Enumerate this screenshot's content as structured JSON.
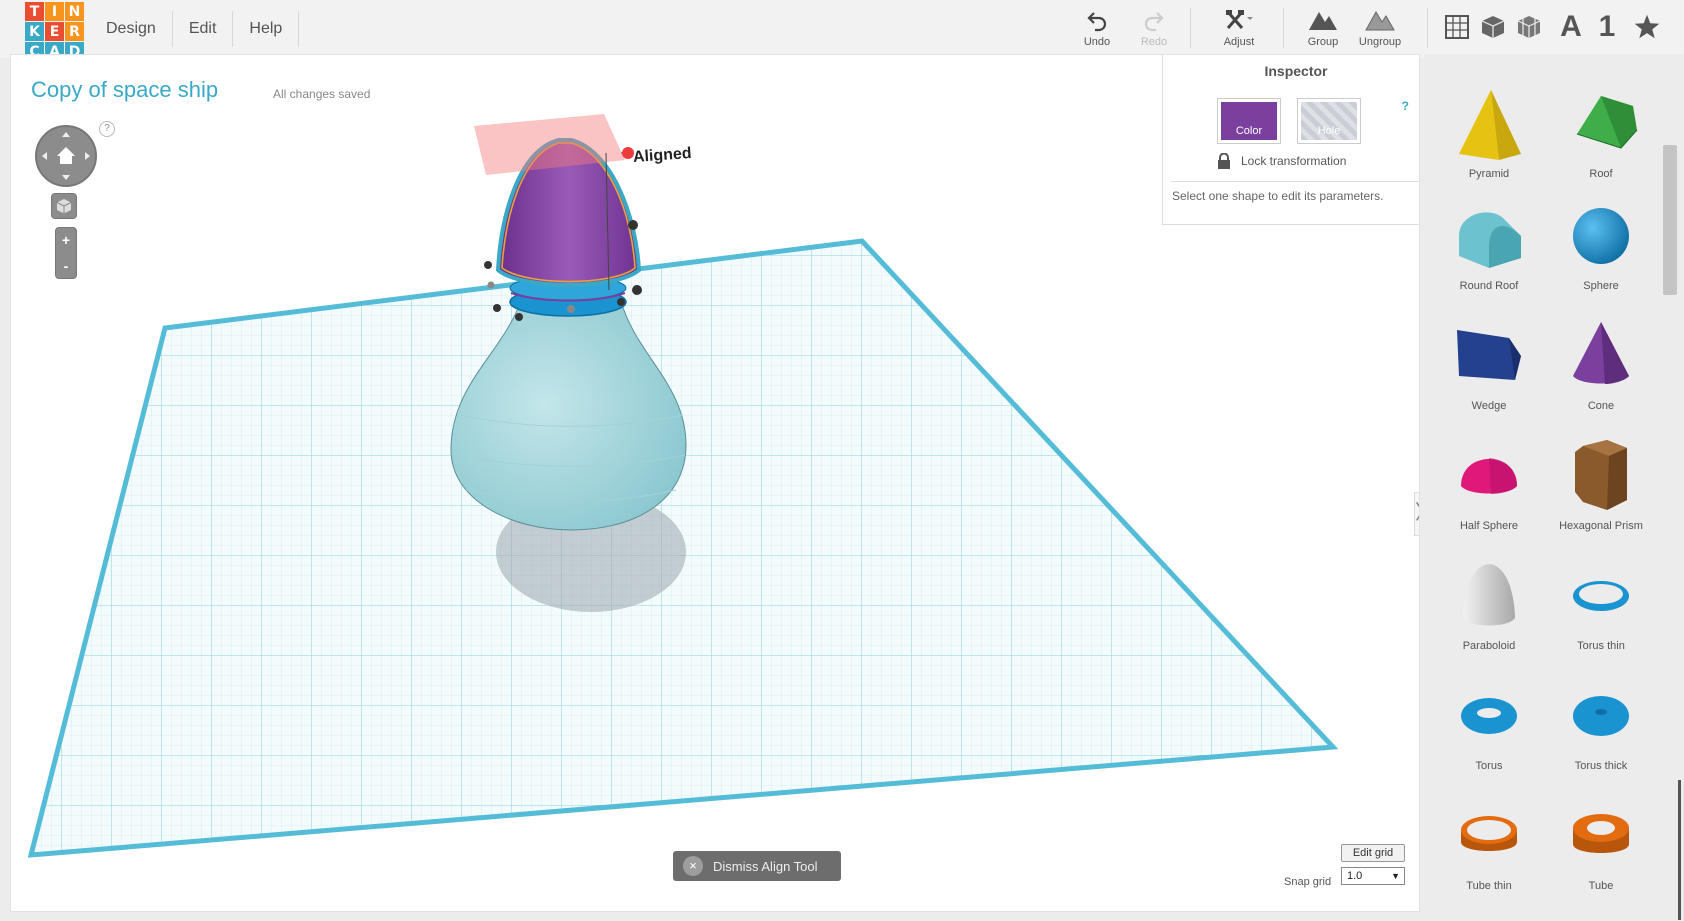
{
  "app": {
    "logo_letters": [
      "T",
      "I",
      "N",
      "K",
      "E",
      "R",
      "C",
      "A",
      "D"
    ],
    "logo_colors": [
      "#e94e33",
      "#f7941e",
      "#f7941e",
      "#3aa9c6",
      "#e94e33",
      "#f7941e",
      "#3aa9c6",
      "#3aa9c6",
      "#3aa9c6"
    ],
    "accent_color": "#3aa9c6"
  },
  "menu": [
    "Design",
    "Edit",
    "Help"
  ],
  "toolbar": {
    "undo": "Undo",
    "redo": "Redo",
    "adjust": "Adjust",
    "group": "Group",
    "ungroup": "Ungroup",
    "view_icons": [
      "grid-view-icon",
      "box-icon",
      "wireframe-box-icon",
      "text-shape-icon",
      "number-shape-icon",
      "star-shape-icon"
    ],
    "text_letter": "A",
    "number_digit": "1"
  },
  "document": {
    "title": "Copy of space ship",
    "save_status": "All changes saved",
    "align_label": "Aligned"
  },
  "inspector": {
    "title": "Inspector",
    "help": "?",
    "color_label": "Color",
    "color_value": "#7b3f9e",
    "hole_label": "Hole",
    "lock_label": "Lock transformation",
    "message": "Select one shape to edit its parameters."
  },
  "viewport": {
    "help": "?",
    "zoom_in": "+",
    "zoom_out": "-",
    "dismiss_label": "Dismiss Align Tool",
    "dismiss_icon": "×",
    "edit_grid": "Edit grid",
    "snap_label": "Snap grid",
    "snap_value": "1.0"
  },
  "shapes": [
    {
      "name": "Pyramid",
      "color": "#f2d21b"
    },
    {
      "name": "Roof",
      "color": "#3fae49"
    },
    {
      "name": "Round Roof",
      "color": "#6cc3cf"
    },
    {
      "name": "Sphere",
      "color": "#1a93d1"
    },
    {
      "name": "Wedge",
      "color": "#24418f"
    },
    {
      "name": "Cone",
      "color": "#7b3f9e"
    },
    {
      "name": "Half Sphere",
      "color": "#e0187a"
    },
    {
      "name": "Hexagonal Prism",
      "color": "#8b5a2b"
    },
    {
      "name": "Paraboloid",
      "color": "#d8d8d8"
    },
    {
      "name": "Torus thin",
      "color": "#1a93d1"
    },
    {
      "name": "Torus",
      "color": "#1a93d1"
    },
    {
      "name": "Torus thick",
      "color": "#1a93d1"
    },
    {
      "name": "Tube thin",
      "color": "#e36b10"
    },
    {
      "name": "Tube",
      "color": "#e36b10"
    }
  ]
}
